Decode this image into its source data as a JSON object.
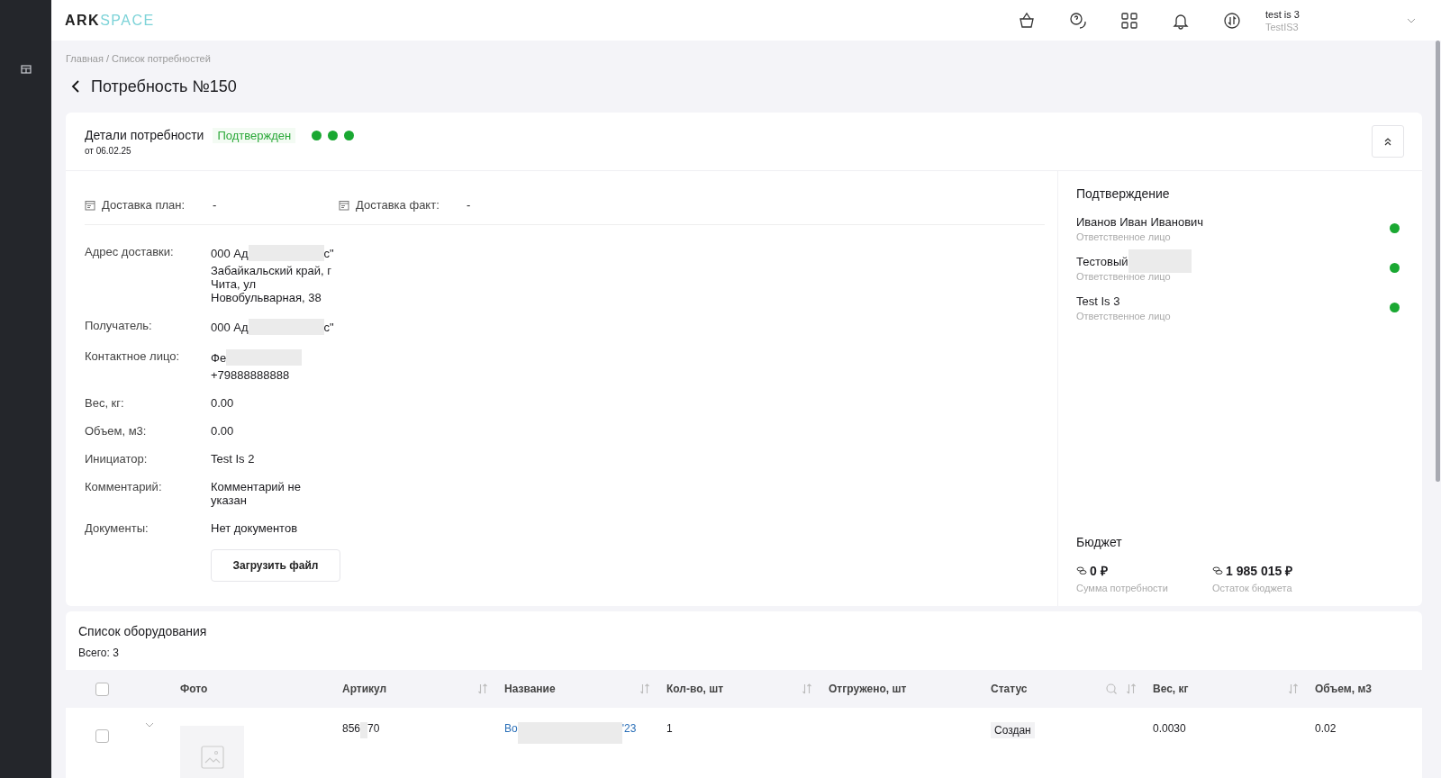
{
  "header": {
    "logo": {
      "part_1": "ARK",
      "part_2": "SPACE"
    },
    "user": {
      "name": "test is 3",
      "login": "TestIS3"
    }
  },
  "breadcrumb": "Главная / Список потребностей",
  "page_title": "Потребность №150",
  "details": {
    "title": "Детали потребности",
    "date": "от 06.02.25",
    "status": "Подтвержден",
    "steps": [
      {
        "done": true
      },
      {
        "done": true
      },
      {
        "done": true
      }
    ],
    "delivery": [
      {
        "label": "Доставка план:",
        "value": "-"
      },
      {
        "label": "Доставка факт:",
        "value": "-"
      }
    ],
    "fields": [
      {
        "label": "Адрес доставки:",
        "lines": [
          {
            "start": "000 Ад",
            "redacted": true,
            "end": "с\""
          },
          {
            "start": "Забайкальский край, г Чита, ул Новобульварная, 38",
            "redacted": false
          }
        ]
      },
      {
        "label": "Получатель:",
        "lines": [
          {
            "start": "000 Ад",
            "redacted": true,
            "end": "с\""
          }
        ]
      },
      {
        "label": "Контактное лицо:",
        "lines": [
          {
            "start": "Фе",
            "redacted": true
          },
          {
            "start": "+79888888888",
            "redacted": false
          }
        ]
      },
      {
        "label": "Вес, кг:",
        "lines": [
          {
            "start": "0.00",
            "redacted": false
          }
        ]
      },
      {
        "label": "Объем, м3:",
        "lines": [
          {
            "start": "0.00",
            "redacted": false
          }
        ]
      },
      {
        "label": "Инициатор:",
        "lines": [
          {
            "start": "Test Is 2",
            "redacted": false
          }
        ]
      },
      {
        "label": "Комментарий:",
        "lines": [
          {
            "start": "Комментарий не указан",
            "redacted": false
          }
        ]
      },
      {
        "label": "Документы:",
        "lines": [
          {
            "start": "Нет документов",
            "redacted": false
          }
        ]
      }
    ],
    "upload_button": "Загрузить файл"
  },
  "confirmation": {
    "title": "Подтверждение",
    "approvers": [
      {
        "name": "Иванов Иван Иванович",
        "redacted": false,
        "role": "Ответственное лицо",
        "approved": true
      },
      {
        "name": "Тестовый",
        "redacted": true,
        "role": "Ответственное лицо",
        "approved": true
      },
      {
        "name": "Test Is 3",
        "redacted": false,
        "role": "Ответственное лицо",
        "approved": true
      }
    ]
  },
  "budget": {
    "title": "Бюджет",
    "items": [
      {
        "value": "0 ₽",
        "label": "Сумма потребности"
      },
      {
        "value": "1 985 015 ₽",
        "label": "Остаток бюджета"
      }
    ]
  },
  "equipment": {
    "title": "Список оборудования",
    "total": "Всего: 3",
    "all_checked": false,
    "columns": [
      {
        "label": "Фото",
        "sortable": false,
        "searchable": false
      },
      {
        "label": "Артикул",
        "sortable": true,
        "searchable": false
      },
      {
        "label": "Название",
        "sortable": true,
        "searchable": false
      },
      {
        "label": "Кол-во, шт",
        "sortable": true,
        "searchable": false
      },
      {
        "label": "Отгружено, шт",
        "sortable": false,
        "searchable": false
      },
      {
        "label": "Статус",
        "sortable": true,
        "searchable": true
      },
      {
        "label": "Вес, кг",
        "sortable": true,
        "searchable": false
      },
      {
        "label": "Объем, м3",
        "sortable": false,
        "searchable": false
      }
    ],
    "rows": [
      {
        "checked": false,
        "expanded": false,
        "article": {
          "start": "856",
          "end": "70"
        },
        "name": {
          "start": "Во",
          "end": "'23"
        },
        "qty": "1",
        "status": "Создан",
        "weight": "0.0030",
        "volume": "0.02"
      }
    ]
  }
}
